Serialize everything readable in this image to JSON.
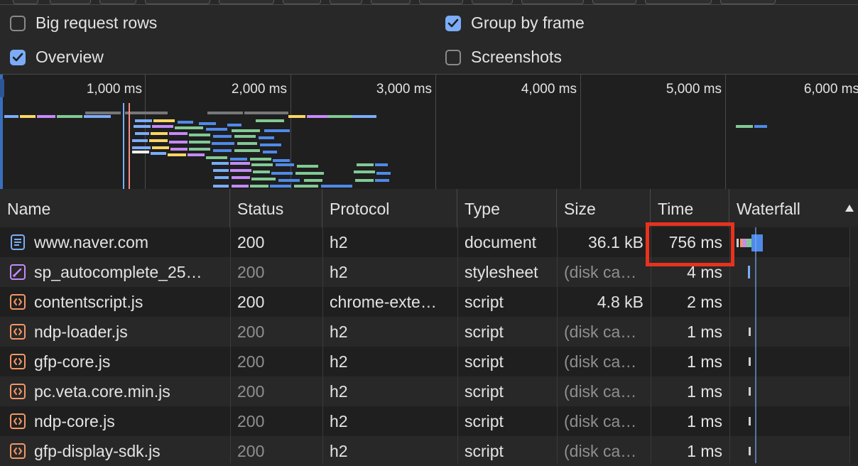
{
  "settings": {
    "big_request_rows": {
      "label": "Big request rows",
      "checked": false
    },
    "group_by_frame": {
      "label": "Group by frame",
      "checked": true
    },
    "overview": {
      "label": "Overview",
      "checked": true
    },
    "screenshots": {
      "label": "Screenshots",
      "checked": false
    }
  },
  "overview": {
    "ticks": [
      "1,000 ms",
      "2,000 ms",
      "3,000 ms",
      "4,000 ms",
      "5,000 ms",
      "6,000 ms"
    ]
  },
  "table": {
    "columns": {
      "name": "Name",
      "status": "Status",
      "protocol": "Protocol",
      "type": "Type",
      "size": "Size",
      "time": "Time",
      "waterfall": "Waterfall"
    },
    "sort_icon": "sort-ascending-icon",
    "rows": [
      {
        "icon": "document-icon",
        "name": "www.naver.com",
        "status": "200",
        "protocol": "h2",
        "type": "document",
        "size": "36.1 kB",
        "time": "756 ms"
      },
      {
        "icon": "stylesheet-icon",
        "name": "sp_autocomplete_25…",
        "status": "200",
        "protocol": "h2",
        "type": "stylesheet",
        "size": "(disk ca…",
        "time": "4 ms"
      },
      {
        "icon": "script-icon",
        "name": "contentscript.js",
        "status": "200",
        "protocol": "chrome-exte…",
        "type": "script",
        "size": "4.8 kB",
        "time": "2 ms"
      },
      {
        "icon": "script-icon",
        "name": "ndp-loader.js",
        "status": "200",
        "protocol": "h2",
        "type": "script",
        "size": "(disk ca…",
        "time": "1 ms"
      },
      {
        "icon": "script-icon",
        "name": "gfp-core.js",
        "status": "200",
        "protocol": "h2",
        "type": "script",
        "size": "(disk ca…",
        "time": "1 ms"
      },
      {
        "icon": "script-icon",
        "name": "pc.veta.core.min.js",
        "status": "200",
        "protocol": "h2",
        "type": "script",
        "size": "(disk ca…",
        "time": "1 ms"
      },
      {
        "icon": "script-icon",
        "name": "ndp-core.js",
        "status": "200",
        "protocol": "h2",
        "type": "script",
        "size": "(disk ca…",
        "time": "1 ms"
      },
      {
        "icon": "script-icon",
        "name": "gfp-display-sdk.js",
        "status": "200",
        "protocol": "h2",
        "type": "script",
        "size": "(disk ca…",
        "time": "1 ms"
      }
    ]
  },
  "colors": {
    "accent": "#7cacf8",
    "highlight": "#e8321e",
    "document_icon": "#7cacf8",
    "stylesheet_icon": "#c58af9",
    "script_icon": "#f29766"
  }
}
